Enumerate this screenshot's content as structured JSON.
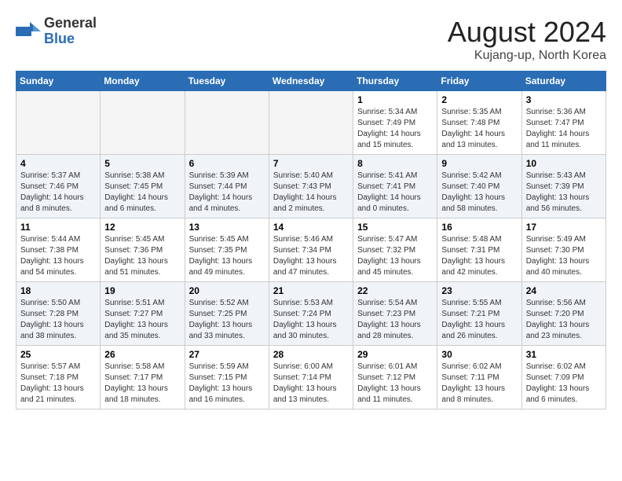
{
  "header": {
    "logo_general": "General",
    "logo_blue": "Blue",
    "month_title": "August 2024",
    "location": "Kujang-up, North Korea"
  },
  "days_of_week": [
    "Sunday",
    "Monday",
    "Tuesday",
    "Wednesday",
    "Thursday",
    "Friday",
    "Saturday"
  ],
  "weeks": [
    [
      {
        "day": "",
        "info": ""
      },
      {
        "day": "",
        "info": ""
      },
      {
        "day": "",
        "info": ""
      },
      {
        "day": "",
        "info": ""
      },
      {
        "day": "1",
        "info": "Sunrise: 5:34 AM\nSunset: 7:49 PM\nDaylight: 14 hours\nand 15 minutes."
      },
      {
        "day": "2",
        "info": "Sunrise: 5:35 AM\nSunset: 7:48 PM\nDaylight: 14 hours\nand 13 minutes."
      },
      {
        "day": "3",
        "info": "Sunrise: 5:36 AM\nSunset: 7:47 PM\nDaylight: 14 hours\nand 11 minutes."
      }
    ],
    [
      {
        "day": "4",
        "info": "Sunrise: 5:37 AM\nSunset: 7:46 PM\nDaylight: 14 hours\nand 8 minutes."
      },
      {
        "day": "5",
        "info": "Sunrise: 5:38 AM\nSunset: 7:45 PM\nDaylight: 14 hours\nand 6 minutes."
      },
      {
        "day": "6",
        "info": "Sunrise: 5:39 AM\nSunset: 7:44 PM\nDaylight: 14 hours\nand 4 minutes."
      },
      {
        "day": "7",
        "info": "Sunrise: 5:40 AM\nSunset: 7:43 PM\nDaylight: 14 hours\nand 2 minutes."
      },
      {
        "day": "8",
        "info": "Sunrise: 5:41 AM\nSunset: 7:41 PM\nDaylight: 14 hours\nand 0 minutes."
      },
      {
        "day": "9",
        "info": "Sunrise: 5:42 AM\nSunset: 7:40 PM\nDaylight: 13 hours\nand 58 minutes."
      },
      {
        "day": "10",
        "info": "Sunrise: 5:43 AM\nSunset: 7:39 PM\nDaylight: 13 hours\nand 56 minutes."
      }
    ],
    [
      {
        "day": "11",
        "info": "Sunrise: 5:44 AM\nSunset: 7:38 PM\nDaylight: 13 hours\nand 54 minutes."
      },
      {
        "day": "12",
        "info": "Sunrise: 5:45 AM\nSunset: 7:36 PM\nDaylight: 13 hours\nand 51 minutes."
      },
      {
        "day": "13",
        "info": "Sunrise: 5:45 AM\nSunset: 7:35 PM\nDaylight: 13 hours\nand 49 minutes."
      },
      {
        "day": "14",
        "info": "Sunrise: 5:46 AM\nSunset: 7:34 PM\nDaylight: 13 hours\nand 47 minutes."
      },
      {
        "day": "15",
        "info": "Sunrise: 5:47 AM\nSunset: 7:32 PM\nDaylight: 13 hours\nand 45 minutes."
      },
      {
        "day": "16",
        "info": "Sunrise: 5:48 AM\nSunset: 7:31 PM\nDaylight: 13 hours\nand 42 minutes."
      },
      {
        "day": "17",
        "info": "Sunrise: 5:49 AM\nSunset: 7:30 PM\nDaylight: 13 hours\nand 40 minutes."
      }
    ],
    [
      {
        "day": "18",
        "info": "Sunrise: 5:50 AM\nSunset: 7:28 PM\nDaylight: 13 hours\nand 38 minutes."
      },
      {
        "day": "19",
        "info": "Sunrise: 5:51 AM\nSunset: 7:27 PM\nDaylight: 13 hours\nand 35 minutes."
      },
      {
        "day": "20",
        "info": "Sunrise: 5:52 AM\nSunset: 7:25 PM\nDaylight: 13 hours\nand 33 minutes."
      },
      {
        "day": "21",
        "info": "Sunrise: 5:53 AM\nSunset: 7:24 PM\nDaylight: 13 hours\nand 30 minutes."
      },
      {
        "day": "22",
        "info": "Sunrise: 5:54 AM\nSunset: 7:23 PM\nDaylight: 13 hours\nand 28 minutes."
      },
      {
        "day": "23",
        "info": "Sunrise: 5:55 AM\nSunset: 7:21 PM\nDaylight: 13 hours\nand 26 minutes."
      },
      {
        "day": "24",
        "info": "Sunrise: 5:56 AM\nSunset: 7:20 PM\nDaylight: 13 hours\nand 23 minutes."
      }
    ],
    [
      {
        "day": "25",
        "info": "Sunrise: 5:57 AM\nSunset: 7:18 PM\nDaylight: 13 hours\nand 21 minutes."
      },
      {
        "day": "26",
        "info": "Sunrise: 5:58 AM\nSunset: 7:17 PM\nDaylight: 13 hours\nand 18 minutes."
      },
      {
        "day": "27",
        "info": "Sunrise: 5:59 AM\nSunset: 7:15 PM\nDaylight: 13 hours\nand 16 minutes."
      },
      {
        "day": "28",
        "info": "Sunrise: 6:00 AM\nSunset: 7:14 PM\nDaylight: 13 hours\nand 13 minutes."
      },
      {
        "day": "29",
        "info": "Sunrise: 6:01 AM\nSunset: 7:12 PM\nDaylight: 13 hours\nand 11 minutes."
      },
      {
        "day": "30",
        "info": "Sunrise: 6:02 AM\nSunset: 7:11 PM\nDaylight: 13 hours\nand 8 minutes."
      },
      {
        "day": "31",
        "info": "Sunrise: 6:02 AM\nSunset: 7:09 PM\nDaylight: 13 hours\nand 6 minutes."
      }
    ]
  ]
}
